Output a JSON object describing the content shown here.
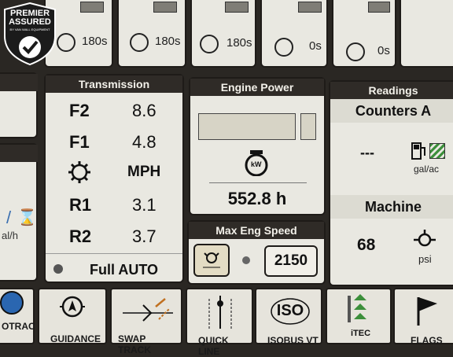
{
  "badge": {
    "line1": "PREMIER",
    "line2": "ASSURED",
    "small": "BY VAN WALL EQUIPMENT"
  },
  "timers": [
    {
      "label": "180s"
    },
    {
      "label": "180s"
    },
    {
      "label": "180s"
    },
    {
      "label": "0s"
    },
    {
      "label": "0s"
    }
  ],
  "transmission": {
    "title": "Transmission",
    "rows": [
      {
        "gear": "F2",
        "value": "8.6"
      },
      {
        "gear": "F1",
        "value": "4.8"
      },
      {
        "gear": "",
        "value": "MPH"
      },
      {
        "gear": "R1",
        "value": "3.1"
      },
      {
        "gear": "R2",
        "value": "3.7"
      }
    ],
    "mode": "Full AUTO"
  },
  "engine_power": {
    "title": "Engine Power",
    "hours": "552.8 h",
    "icon_text": "kW"
  },
  "max_eng_speed": {
    "title": "Max Eng Speed",
    "value": "2150"
  },
  "readings": {
    "title": "Readings",
    "counters_title": "Counters A",
    "counters_value": "---",
    "counters_unit": "gal/ac",
    "machine_title": "Machine",
    "machine_value": "68",
    "machine_unit": "psi"
  },
  "left_panel": {
    "unit": "al/h"
  },
  "bottom_bar": [
    {
      "label": "OTRAC"
    },
    {
      "label": "GUIDANCE"
    },
    {
      "label": "SWAP TRACK"
    },
    {
      "label": "QUICK LINE"
    },
    {
      "label": "ISOBUS VT"
    },
    {
      "label": "iTEC"
    },
    {
      "label": "FLAGS"
    }
  ],
  "iso_text": "ISO",
  "colors": {
    "panel": "#e9e8e1",
    "header": "#2f2b27",
    "frame": "#2a2723",
    "accent_green": "#3c8f3b"
  }
}
